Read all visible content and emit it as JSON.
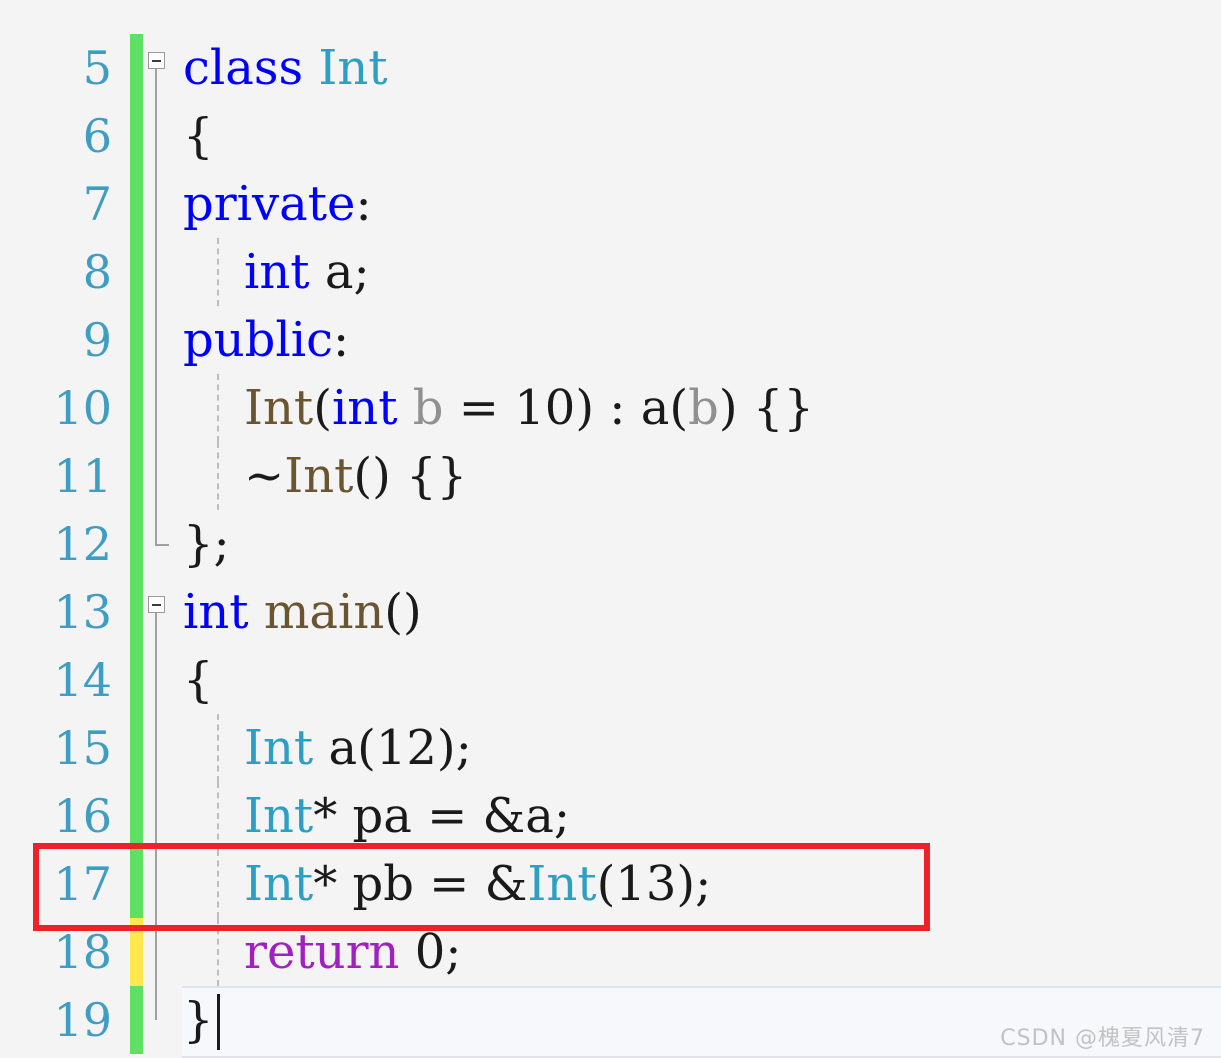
{
  "editor": {
    "language": "C++",
    "first_visible_line": 5,
    "last_visible_line": 19,
    "cursor_line": 19,
    "colors": {
      "background": "#f4f4f4",
      "line_number": "#3d9dc2",
      "keyword": "#0000ff",
      "type_name": "#2d9fc4",
      "function_name": "#6b5430",
      "parameter": "#909090",
      "return_keyword": "#a020c0",
      "plain_text": "#1a1a1a",
      "change_bar_added": "#5fe065",
      "change_bar_modified": "#ffe84d",
      "annotation_rect": "#ee2028",
      "current_line_background": "#f7f8fb"
    },
    "lines": [
      {
        "number": "5",
        "change": "added",
        "fold": "start",
        "fold_line": "half-bottom",
        "indent_guide": false,
        "tokens": [
          {
            "text": "class",
            "cls": "kw"
          },
          {
            "text": " ",
            "cls": "plain"
          },
          {
            "text": "Int",
            "cls": "type"
          }
        ]
      },
      {
        "number": "6",
        "change": "added",
        "fold": "line",
        "fold_line": "full",
        "indent_guide": false,
        "tokens": [
          {
            "text": "{",
            "cls": "plain"
          }
        ]
      },
      {
        "number": "7",
        "change": "added",
        "fold": "line",
        "fold_line": "full",
        "indent_guide": false,
        "tokens": [
          {
            "text": "private",
            "cls": "kw"
          },
          {
            "text": ":",
            "cls": "plain"
          }
        ]
      },
      {
        "number": "8",
        "change": "added",
        "fold": "line",
        "fold_line": "full",
        "indent_guide": true,
        "tokens": [
          {
            "text": "    ",
            "cls": "plain"
          },
          {
            "text": "int",
            "cls": "kw"
          },
          {
            "text": " ",
            "cls": "plain"
          },
          {
            "text": "a;",
            "cls": "plain"
          }
        ]
      },
      {
        "number": "9",
        "change": "added",
        "fold": "line",
        "fold_line": "full",
        "indent_guide": false,
        "tokens": [
          {
            "text": "public",
            "cls": "kw"
          },
          {
            "text": ":",
            "cls": "plain"
          }
        ]
      },
      {
        "number": "10",
        "change": "added",
        "fold": "line",
        "fold_line": "full",
        "indent_guide": true,
        "tokens": [
          {
            "text": "    ",
            "cls": "plain"
          },
          {
            "text": "Int",
            "cls": "fn"
          },
          {
            "text": "(",
            "cls": "plain"
          },
          {
            "text": "int",
            "cls": "kw"
          },
          {
            "text": " ",
            "cls": "plain"
          },
          {
            "text": "b",
            "cls": "ident"
          },
          {
            "text": " = ",
            "cls": "plain"
          },
          {
            "text": "10",
            "cls": "plain"
          },
          {
            "text": ") : ",
            "cls": "plain"
          },
          {
            "text": "a",
            "cls": "plain"
          },
          {
            "text": "(",
            "cls": "plain"
          },
          {
            "text": "b",
            "cls": "ident"
          },
          {
            "text": ") {}",
            "cls": "plain"
          }
        ]
      },
      {
        "number": "11",
        "change": "added",
        "fold": "line",
        "fold_line": "full",
        "indent_guide": true,
        "tokens": [
          {
            "text": "    ",
            "cls": "plain"
          },
          {
            "text": "~",
            "cls": "plain"
          },
          {
            "text": "Int",
            "cls": "fn"
          },
          {
            "text": "() {}",
            "cls": "plain"
          }
        ]
      },
      {
        "number": "12",
        "change": "added",
        "fold": "end",
        "fold_line": "corner",
        "indent_guide": false,
        "tokens": [
          {
            "text": "};",
            "cls": "plain"
          }
        ]
      },
      {
        "number": "13",
        "change": "added",
        "fold": "start",
        "fold_line": "half-bottom",
        "indent_guide": false,
        "tokens": [
          {
            "text": "int",
            "cls": "kw"
          },
          {
            "text": " ",
            "cls": "plain"
          },
          {
            "text": "main",
            "cls": "fn"
          },
          {
            "text": "()",
            "cls": "plain"
          }
        ]
      },
      {
        "number": "14",
        "change": "added",
        "fold": "line",
        "fold_line": "full",
        "indent_guide": false,
        "tokens": [
          {
            "text": "{",
            "cls": "plain"
          }
        ]
      },
      {
        "number": "15",
        "change": "added",
        "fold": "line",
        "fold_line": "full",
        "indent_guide": true,
        "tokens": [
          {
            "text": "    ",
            "cls": "plain"
          },
          {
            "text": "Int",
            "cls": "type"
          },
          {
            "text": " ",
            "cls": "plain"
          },
          {
            "text": "a",
            "cls": "plain"
          },
          {
            "text": "(",
            "cls": "plain"
          },
          {
            "text": "12",
            "cls": "plain"
          },
          {
            "text": ");",
            "cls": "plain"
          }
        ]
      },
      {
        "number": "16",
        "change": "added",
        "fold": "line",
        "fold_line": "full",
        "indent_guide": true,
        "tokens": [
          {
            "text": "    ",
            "cls": "plain"
          },
          {
            "text": "Int",
            "cls": "type"
          },
          {
            "text": "* ",
            "cls": "plain"
          },
          {
            "text": "pa",
            "cls": "plain"
          },
          {
            "text": " = &",
            "cls": "plain"
          },
          {
            "text": "a;",
            "cls": "plain"
          }
        ]
      },
      {
        "number": "17",
        "change": "added",
        "fold": "line",
        "fold_line": "full",
        "indent_guide": true,
        "highlighted": true,
        "tokens": [
          {
            "text": "    ",
            "cls": "plain"
          },
          {
            "text": "Int",
            "cls": "type"
          },
          {
            "text": "* ",
            "cls": "plain"
          },
          {
            "text": "pb",
            "cls": "plain"
          },
          {
            "text": " = &",
            "cls": "plain"
          },
          {
            "text": "Int",
            "cls": "type"
          },
          {
            "text": "(",
            "cls": "plain"
          },
          {
            "text": "13",
            "cls": "plain"
          },
          {
            "text": ");",
            "cls": "plain"
          }
        ]
      },
      {
        "number": "18",
        "change": "modified",
        "fold": "line",
        "fold_line": "full",
        "indent_guide": true,
        "tokens": [
          {
            "text": "    ",
            "cls": "plain"
          },
          {
            "text": "return",
            "cls": "ret"
          },
          {
            "text": " ",
            "cls": "plain"
          },
          {
            "text": "0;",
            "cls": "plain"
          }
        ]
      },
      {
        "number": "19",
        "change": "added",
        "fold": "end",
        "fold_line": "half-top",
        "indent_guide": false,
        "current": true,
        "tokens": [
          {
            "text": "}",
            "cls": "plain"
          }
        ]
      }
    ]
  },
  "annotation": {
    "name": "red-highlight-rectangle",
    "target_line": "17",
    "color": "#ee2028"
  },
  "watermark": {
    "text": "CSDN @槐夏风清7"
  }
}
